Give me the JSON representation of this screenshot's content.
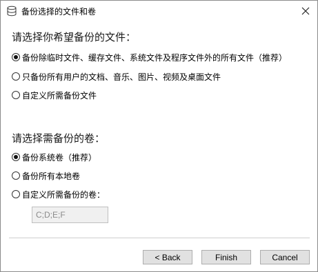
{
  "window": {
    "title": "备份选择的文件和卷",
    "icon": "database-icon"
  },
  "files_section": {
    "heading": "请选择你希望备份的文件：",
    "options": [
      {
        "label": "备份除临时文件、缓存文件、系统文件及程序文件外的所有文件（推荐）",
        "selected": true
      },
      {
        "label": "只备份所有用户的文档、音乐、图片、视频及桌面文件",
        "selected": false
      },
      {
        "label": "自定义所需备份文件",
        "selected": false
      }
    ]
  },
  "volumes_section": {
    "heading": "请选择需备份的卷：",
    "options": [
      {
        "label": "备份系统卷（推荐）",
        "selected": true
      },
      {
        "label": "备份所有本地卷",
        "selected": false
      },
      {
        "label": "自定义所需备份的卷：",
        "selected": false
      }
    ],
    "custom_volumes_value": "C;D;E;F"
  },
  "buttons": {
    "back": "< Back",
    "finish": "Finish",
    "cancel": "Cancel"
  }
}
